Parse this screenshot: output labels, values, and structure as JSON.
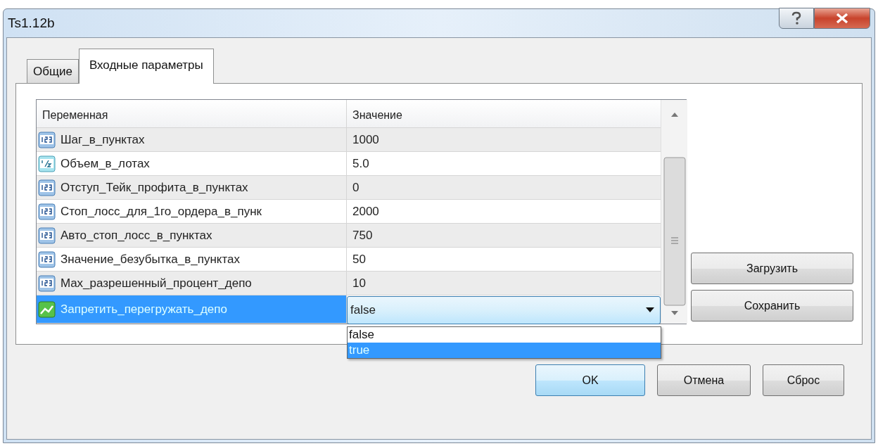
{
  "window": {
    "title": "Ts1.12b"
  },
  "tabs": [
    {
      "label": "Общие",
      "selected": false
    },
    {
      "label": "Входные параметры",
      "selected": true
    }
  ],
  "table": {
    "columns": [
      "Переменная",
      "Значение"
    ],
    "rows": [
      {
        "kind": "int",
        "name": "Шаг_в_пунктах",
        "value": "1000",
        "selected": false
      },
      {
        "kind": "double",
        "name": "Объем_в_лотах",
        "value": "5.0",
        "selected": false
      },
      {
        "kind": "int",
        "name": "Отступ_Тейк_профита_в_пунктах",
        "value": "0",
        "selected": false
      },
      {
        "kind": "int",
        "name": "Стоп_лосс_для_1го_ордера_в_пунк",
        "value": "2000",
        "selected": false
      },
      {
        "kind": "int",
        "name": "Авто_стоп_лосс_в_пунктах",
        "value": "750",
        "selected": false
      },
      {
        "kind": "int",
        "name": "Значение_безубытка_в_пунктах",
        "value": "50",
        "selected": false
      },
      {
        "kind": "int",
        "name": "Max_разрешенный_процент_депо",
        "value": "10",
        "selected": false
      },
      {
        "kind": "bool",
        "name": "Запретить_перегружать_депо",
        "value": "false",
        "selected": true,
        "expanded": true,
        "options": [
          {
            "label": "false",
            "highlighted": false
          },
          {
            "label": "true",
            "highlighted": true
          }
        ]
      }
    ]
  },
  "side_buttons": [
    "Загрузить",
    "Сохранить"
  ],
  "buttons": [
    {
      "label": "OK",
      "default": true
    },
    {
      "label": "Отмена",
      "default": false
    },
    {
      "label": "Сброс",
      "default": false
    }
  ]
}
